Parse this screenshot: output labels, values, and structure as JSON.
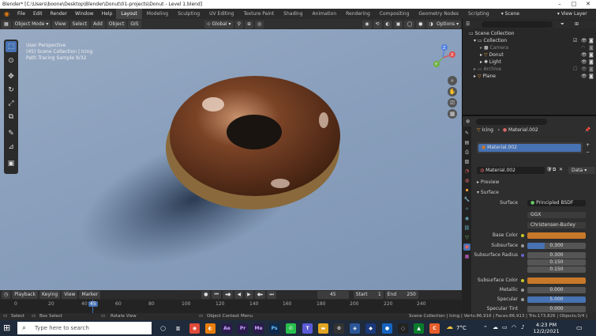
{
  "titlebar": {
    "title": "Blender* [C:\\Users\\boone\\Desktop\\Blender\\Donut\\01-projects\\Donut - Level 1.blend]"
  },
  "menu": [
    "File",
    "Edit",
    "Render",
    "Window",
    "Help"
  ],
  "workspaces": [
    "Layout",
    "Modeling",
    "Sculpting",
    "UV Editing",
    "Texture Paint",
    "Shading",
    "Animation",
    "Rendering",
    "Compositing",
    "Geometry Nodes",
    "Scripting"
  ],
  "scene": {
    "name": "Scene",
    "view_layer": "View Layer"
  },
  "viewport_header": {
    "mode": "Object Mode",
    "menus": [
      "View",
      "Select",
      "Add",
      "Object",
      "GIS"
    ],
    "transform": "Global",
    "options": "Options"
  },
  "overlay": {
    "line1": "User Perspective",
    "line2": "(45) Scene Collection | Icing",
    "line3": "Path Tracing Sample 9/32"
  },
  "gizmo": {
    "x": "X",
    "y": "Y",
    "z": "Z"
  },
  "outliner": {
    "root": "Scene Collection",
    "items": [
      {
        "label": "Collection"
      },
      {
        "label": "Camera"
      },
      {
        "label": "Donut"
      },
      {
        "label": "Light"
      },
      {
        "label": "Archive"
      },
      {
        "label": "Plane"
      }
    ]
  },
  "properties": {
    "object": "Icing",
    "material": "Material.002",
    "slot": "Material.002",
    "data_label": "Data",
    "sections": {
      "preview": "Preview",
      "surface": "Surface"
    },
    "surface_label": "Surface",
    "surface_value": "Principled BSDF",
    "distribution": "GGX",
    "subsurface_method": "Christensen-Burley",
    "rows": {
      "base_color": "Base Color",
      "subsurface": "Subsurface",
      "subsurface_val": "0.300",
      "subsurface_radius": "Subsurface Radius",
      "radius": [
        "0.300",
        "0.150",
        "0.150"
      ],
      "subsurface_color": "Subsurface Color",
      "metallic": "Metallic",
      "metallic_val": "0.000",
      "specular": "Specular",
      "specular_val": "5.000",
      "specular_tint": "Specular Tint",
      "specular_tint_val": "0.000"
    }
  },
  "timeline": {
    "menus": [
      "Playback",
      "Keying",
      "View",
      "Marker"
    ],
    "current": "45",
    "start_label": "Start",
    "start": "1",
    "end_label": "End",
    "end": "250",
    "ticks": [
      "0",
      "20",
      "40",
      "45",
      "60",
      "80",
      "100",
      "120",
      "140",
      "160",
      "180",
      "200",
      "220",
      "240"
    ]
  },
  "statusbar": {
    "select": "Select",
    "box_select": "Box Select",
    "rotate_view": "Rotate View",
    "context_menu": "Object Context Menu",
    "stats": "Scene Collection | Icing | Verts:86,916 | Faces:86,913 | Tris:173,826 | Objects:0/4 | 2.93.5"
  },
  "taskbar": {
    "search_placeholder": "Type here to search",
    "apps": [
      "Ae",
      "Pr",
      "Me",
      "Ps"
    ],
    "temperature": "7°C",
    "time": "4:23 PM",
    "date": "12/2/2021"
  },
  "colors": {
    "accent": "#4772b3",
    "orange": "#c7782a",
    "icing": "#6b3a1e"
  }
}
